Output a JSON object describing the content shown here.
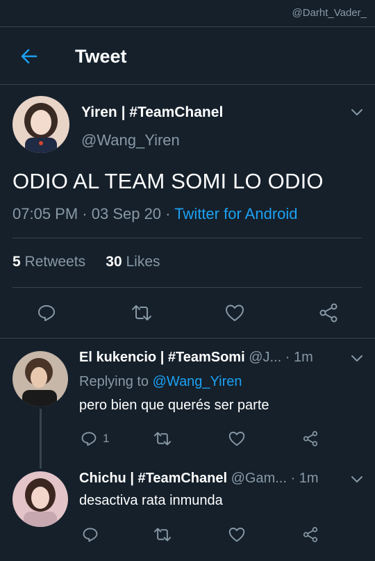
{
  "watermark": "@Darht_Vader_",
  "header": {
    "title": "Tweet"
  },
  "tweet": {
    "author_name": "Yiren | #TeamChanel",
    "author_handle": "@Wang_Yiren",
    "text": "ODIO AL TEAM SOMI LO ODIO",
    "time": "07:05 PM",
    "sep1": " · ",
    "date": "03 Sep 20",
    "sep2": " · ",
    "source": "Twitter for Android",
    "retweets": "5",
    "retweets_label": "Retweets",
    "likes": "30",
    "likes_label": "Likes"
  },
  "replies": [
    {
      "author_name": "El kukencio | #TeamSomi",
      "author_handle": "@J...",
      "time": "· 1m",
      "replying_to_label": "Replying to",
      "replying_to_handle": "@Wang_Yiren",
      "text": "pero bien que querés ser parte",
      "reply_count": "1"
    },
    {
      "author_name": "Chichu | #TeamChanel",
      "author_handle": "@Gam...",
      "time": "· 1m",
      "text": "desactiva rata inmunda"
    }
  ],
  "colors": {
    "background": "#15202b",
    "accent": "#1da1f2",
    "secondary_text": "#8899a6",
    "divider": "#38444d"
  },
  "icons": {
    "back": "arrow-left-icon",
    "reply": "speech-bubble-icon",
    "retweet": "retweet-icon",
    "like": "heart-icon",
    "share": "share-icon",
    "more": "chevron-down-icon"
  }
}
